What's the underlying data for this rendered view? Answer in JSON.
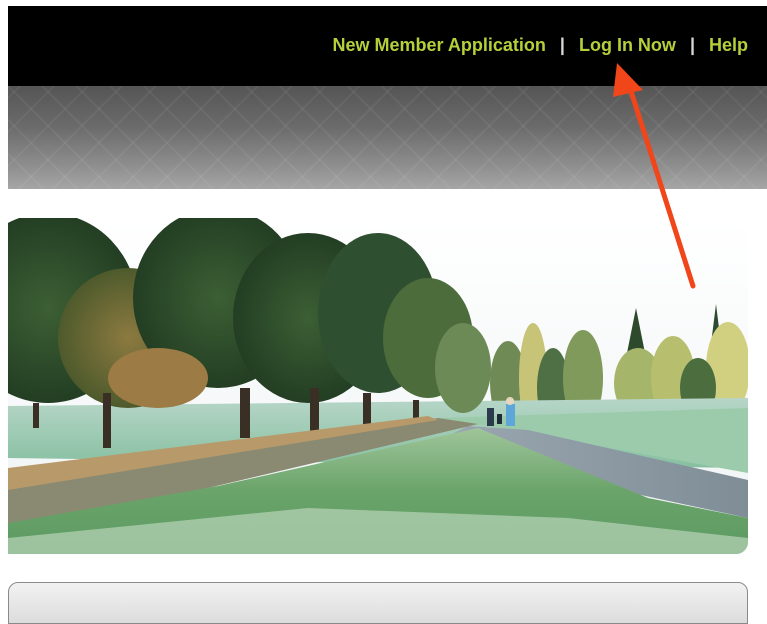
{
  "header": {
    "links": [
      {
        "label": "New Member Application",
        "icon": ""
      },
      {
        "label": "Log In Now",
        "icon": ""
      },
      {
        "label": "Help",
        "icon": ""
      }
    ],
    "separator": "|"
  },
  "colors": {
    "nav_background": "#000000",
    "nav_link": "#b5cf3b",
    "separator": "#d8d8d8",
    "annotation_arrow": "#f0461a"
  },
  "hero": {
    "icon": "golf-course-photo"
  },
  "annotation": {
    "icon": "red-arrow-icon"
  }
}
